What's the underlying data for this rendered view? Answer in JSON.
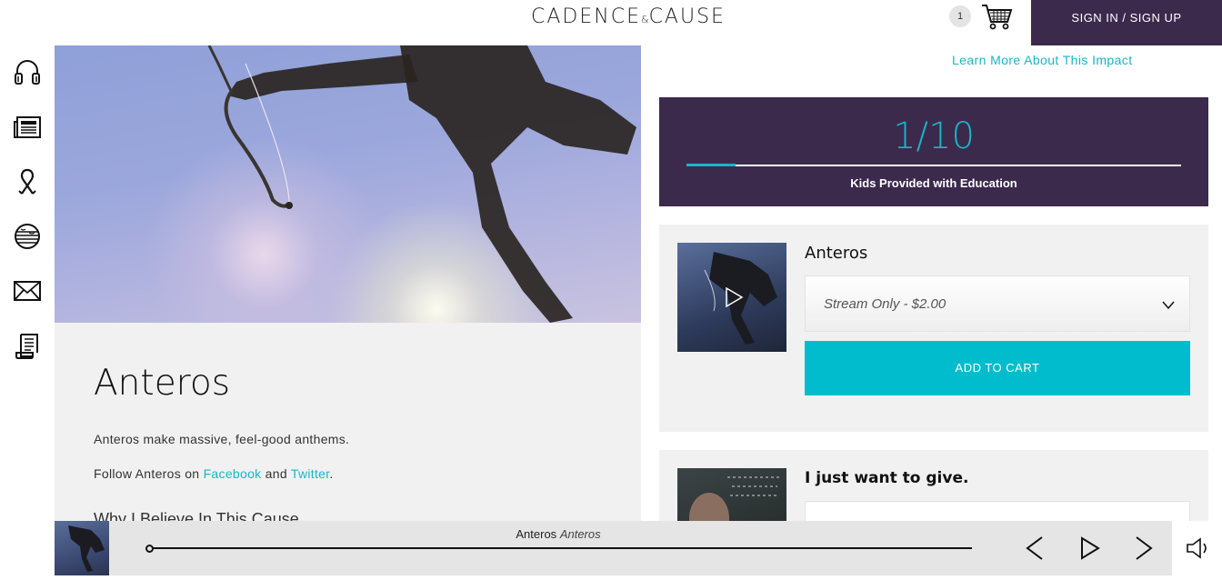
{
  "header": {
    "logo_main": "CADENCE",
    "logo_amp": "&",
    "logo_end": "CAUSE",
    "cart_count": "1",
    "cart_icon": "cart-icon",
    "signin_label": "SIGN IN / SIGN UP"
  },
  "sidebar": {
    "items": [
      {
        "name": "headphones-icon"
      },
      {
        "name": "newspaper-icon"
      },
      {
        "name": "ribbon-icon"
      },
      {
        "name": "globe-icon"
      },
      {
        "name": "mail-icon"
      },
      {
        "name": "scroll-icon"
      }
    ]
  },
  "artist": {
    "name": "Anteros",
    "description": "Anteros make massive, feel-good anthems.",
    "follow_prefix": "Follow Anteros on ",
    "facebook": "Facebook",
    "follow_and": " and ",
    "twitter": "Twitter",
    "follow_suffix": ".",
    "why_heading": "Why I Believe In This Cause"
  },
  "impact": {
    "learn_more": "Learn More About This Impact",
    "count": "1/10",
    "progress": 0.1,
    "label": "Kids Provided with Education"
  },
  "product": {
    "title": "Anteros",
    "selected_option": "Stream Only - $2.00",
    "add_to_cart": "ADD TO CART"
  },
  "give": {
    "title": "I just want to give."
  },
  "player": {
    "artist": "Anteros",
    "track": "Anteros",
    "progress": 0.0
  },
  "colors": {
    "accent": "#00bccc",
    "brand_purple": "#3c2a4d"
  }
}
